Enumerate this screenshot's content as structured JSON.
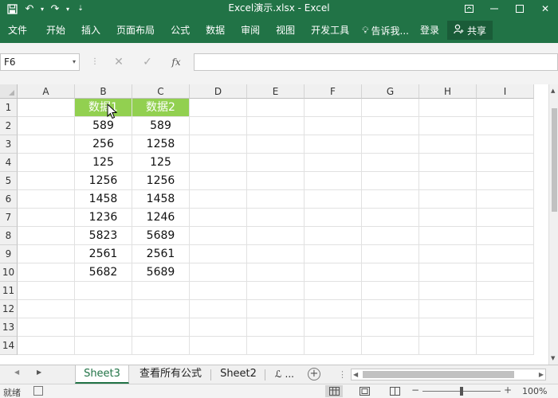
{
  "window": {
    "title": "Excel演示.xlsx - Excel"
  },
  "ribbon": {
    "tabs": [
      "文件",
      "开始",
      "插入",
      "页面布局",
      "公式",
      "数据",
      "审阅",
      "视图",
      "开发工具"
    ],
    "tell_me": "告诉我...",
    "login": "登录",
    "share": "共享"
  },
  "formula_bar": {
    "name_box": "F6",
    "fx_label": "fx",
    "formula": ""
  },
  "grid": {
    "columns": [
      "A",
      "B",
      "C",
      "D",
      "E",
      "F",
      "G",
      "H",
      "I"
    ],
    "rows": [
      "1",
      "2",
      "3",
      "4",
      "5",
      "6",
      "7",
      "8",
      "9",
      "10",
      "11",
      "12",
      "13",
      "14"
    ],
    "header_fill": "#92D050",
    "data": [
      [
        "数据1",
        "数据2"
      ],
      [
        "589",
        "589"
      ],
      [
        "256",
        "1258"
      ],
      [
        "125",
        "125"
      ],
      [
        "1256",
        "1256"
      ],
      [
        "1458",
        "1458"
      ],
      [
        "1236",
        "1246"
      ],
      [
        "5823",
        "5689"
      ],
      [
        "2561",
        "2561"
      ],
      [
        "5682",
        "5689"
      ]
    ]
  },
  "sheets": {
    "tabs": [
      "Sheet3",
      "查看所有公式",
      "Sheet2",
      "ℒ ..."
    ],
    "active": "Sheet3"
  },
  "status": {
    "ready": "就绪",
    "zoom": "100%"
  },
  "colors": {
    "excel_green": "#217346"
  }
}
